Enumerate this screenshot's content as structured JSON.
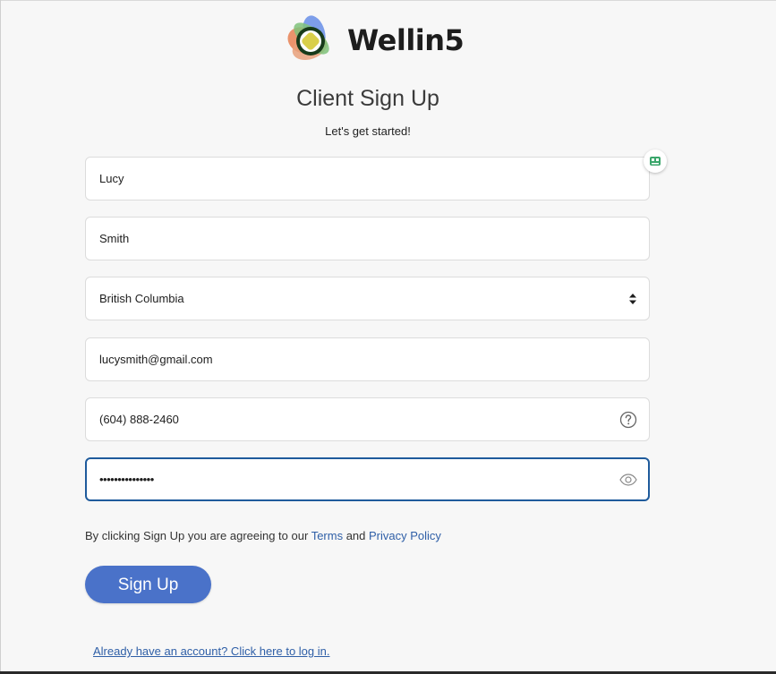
{
  "brand": {
    "name": "Wellin5",
    "colors": {
      "primary_button": "#4a72c9",
      "link": "#2f5fa7",
      "focus_border": "#1f5b9c"
    }
  },
  "page": {
    "title": "Client Sign Up",
    "subtitle": "Let's get started!"
  },
  "form": {
    "first_name": {
      "value": "Lucy"
    },
    "last_name": {
      "value": "Smith"
    },
    "province": {
      "selected": "British Columbia",
      "icon": "select-arrows-icon"
    },
    "email": {
      "value": "lucysmith@gmail.com"
    },
    "phone": {
      "value": "(604) 888-2460",
      "icon": "help-icon"
    },
    "password": {
      "masked_value": "•••••••••••••••",
      "icon": "eye-icon",
      "focused": true
    }
  },
  "agreement": {
    "prefix": "By clicking Sign Up you are agreeing to our ",
    "terms": "Terms",
    "middle": " and ",
    "privacy": "Privacy Policy"
  },
  "actions": {
    "signup_label": "Sign Up",
    "login_link": "Already have an account? Click here to log in."
  }
}
